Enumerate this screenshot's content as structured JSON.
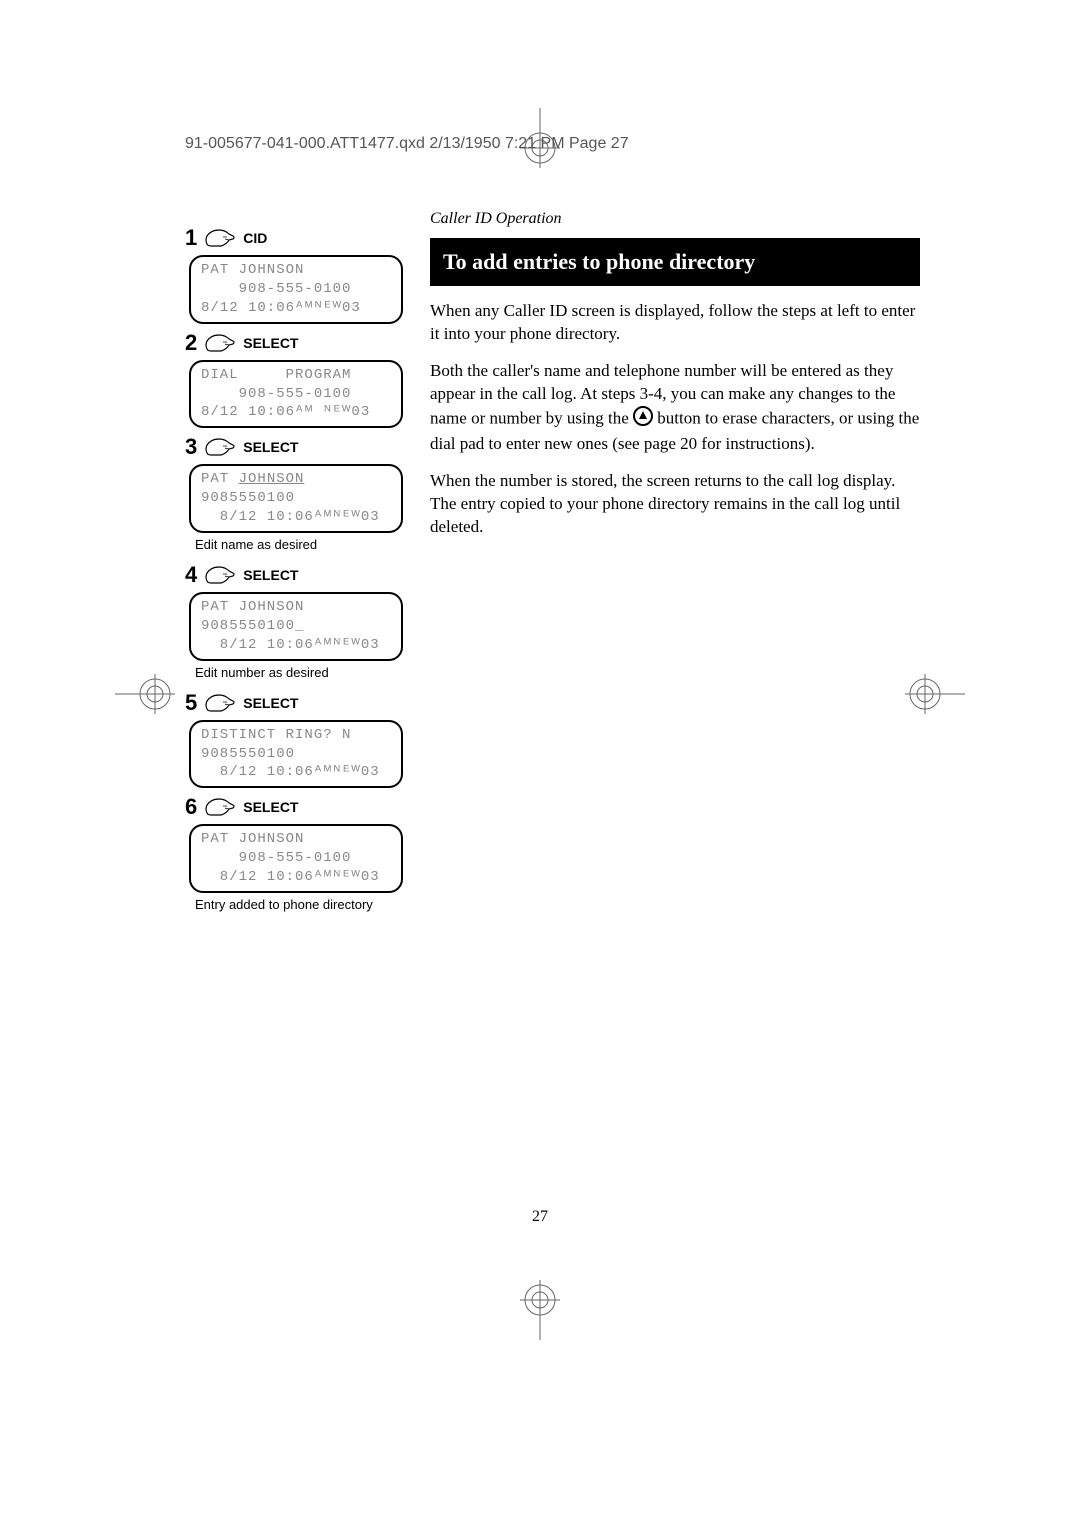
{
  "print_header": "91-005677-041-000.ATT1477.qxd  2/13/1950  7:21 PM  Page 27",
  "section_label": "Caller ID Operation",
  "title": "To add entries to phone directory",
  "paragraphs": [
    "When any Caller ID screen is displayed, follow the steps at left to enter it into your phone directory.",
    "Both the caller's name and telephone number will be entered as they appear in the call log. At steps 3-4, you can make any changes to the name or number by using the ⬤ button to erase characters, or using the dial pad to enter new ones (see page 20 for instructions).",
    "When the number is stored, the screen returns to the call log display. The entry copied to your phone directory remains in the call log until deleted."
  ],
  "steps": [
    {
      "num": "1",
      "label": "CID",
      "lcd": [
        "PAT JOHNSON",
        "    908-555-0100",
        "8/12 10:06ᴬᴹᴺᴱᵂ03"
      ],
      "caption": ""
    },
    {
      "num": "2",
      "label": "SELECT",
      "lcd": [
        "DIAL     PROGRAM",
        "    908-555-0100",
        "8/12 10:06ᴬᴹ ᴺᴱᵂ03"
      ],
      "caption": ""
    },
    {
      "num": "3",
      "label": "SELECT",
      "lcd": [
        "PAT JOHNSON",
        "9085550100",
        "  8/12 10:06ᴬᴹᴺᴱᵂ03"
      ],
      "caption": "Edit name as desired",
      "underline_first": true
    },
    {
      "num": "4",
      "label": "SELECT",
      "lcd": [
        "PAT JOHNSON",
        "9085550100_",
        "  8/12 10:06ᴬᴹᴺᴱᵂ03"
      ],
      "caption": "Edit number as desired"
    },
    {
      "num": "5",
      "label": "SELECT",
      "lcd": [
        "DISTINCT RING? N",
        "9085550100",
        "  8/12 10:06ᴬᴹᴺᴱᵂ03"
      ],
      "caption": ""
    },
    {
      "num": "6",
      "label": "SELECT",
      "lcd": [
        "PAT JOHNSON",
        "    908-555-0100",
        "  8/12 10:06ᴬᴹᴺᴱᵂ03"
      ],
      "caption": "Entry added to phone directory"
    }
  ],
  "page_number": "27"
}
